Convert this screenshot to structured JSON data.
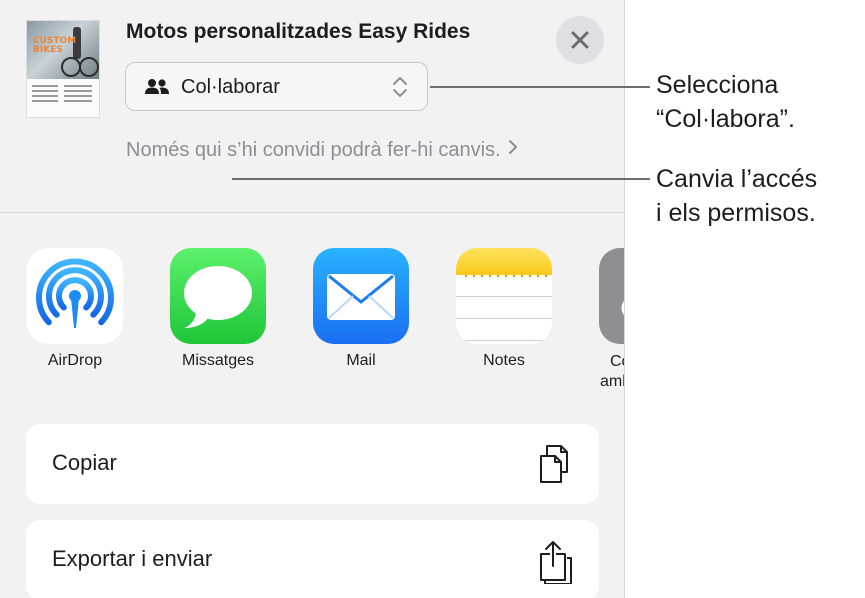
{
  "document": {
    "title": "Motos personalitzades Easy Rides",
    "thumbnail_text": "CUSTOM BIKES"
  },
  "collaboration": {
    "mode_label": "Col·laborar",
    "access_note": "Només qui s’hi convidi podrà fer-hi canvis."
  },
  "apps": [
    {
      "name": "AirDrop",
      "icon": "airdrop-icon"
    },
    {
      "name": "Missatges",
      "icon": "messages-icon"
    },
    {
      "name": "Mail",
      "icon": "mail-icon"
    },
    {
      "name": "Notes",
      "icon": "notes-icon"
    },
    {
      "name": "Co\namb",
      "icon": "more-app-icon"
    }
  ],
  "actions": [
    {
      "label": "Copiar",
      "icon": "copy-icon"
    },
    {
      "label": "Exportar i enviar",
      "icon": "export-share-icon"
    }
  ],
  "callouts": [
    {
      "line1": "Selecciona",
      "line2": "“Col·labora”."
    },
    {
      "line1": "Canvia l’accés",
      "line2": "i els permisos."
    }
  ],
  "colors": {
    "sheet_background": "#f2f2f2",
    "airdrop_blue": "#1e8cf0",
    "messages_green": "#2fd04a",
    "mail_blue": "#1a8cff",
    "notes_yellow": "#f8c91a",
    "secondary_text": "#8e8e93"
  }
}
